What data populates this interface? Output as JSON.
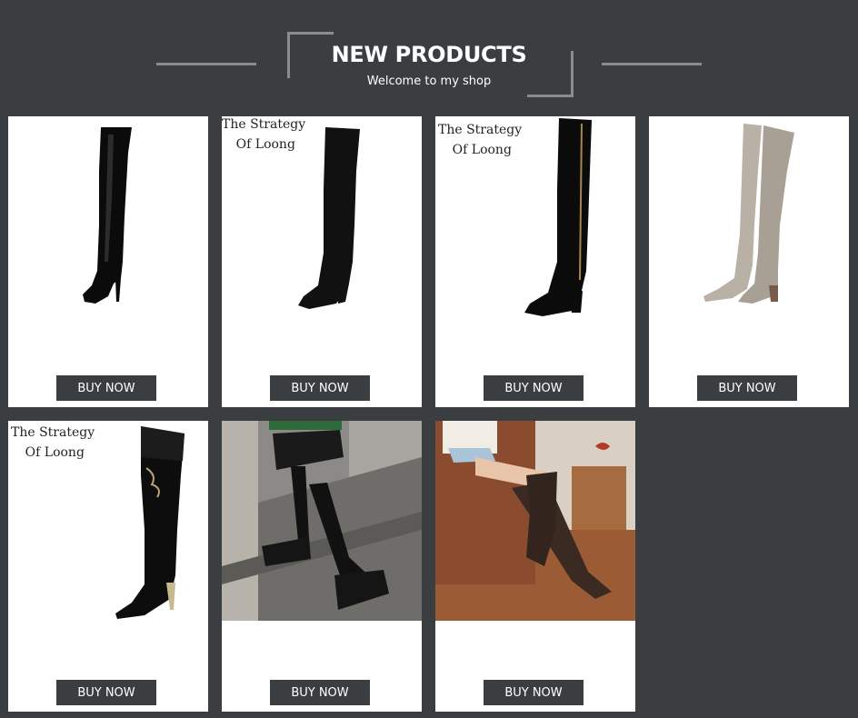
{
  "header": {
    "title": "NEW PRODUCTS",
    "subtitle": "Welcome to my shop"
  },
  "products": [
    {
      "button_label": "BUY NOW",
      "watermark": ""
    },
    {
      "button_label": "BUY NOW",
      "watermark": "The Strategy\n Of Loong"
    },
    {
      "button_label": "BUY NOW",
      "watermark": "The Strategy\n Of Loong"
    },
    {
      "button_label": "BUY NOW",
      "watermark": ""
    },
    {
      "button_label": "BUY NOW",
      "watermark": "The Strategy\n Of Loong"
    },
    {
      "button_label": "BUY NOW",
      "watermark": ""
    },
    {
      "button_label": "BUY NOW",
      "watermark": ""
    }
  ],
  "colors": {
    "background": "#3b3e41",
    "card": "#ffffff",
    "button": "#3b3e41",
    "button_text": "#ffffff"
  }
}
